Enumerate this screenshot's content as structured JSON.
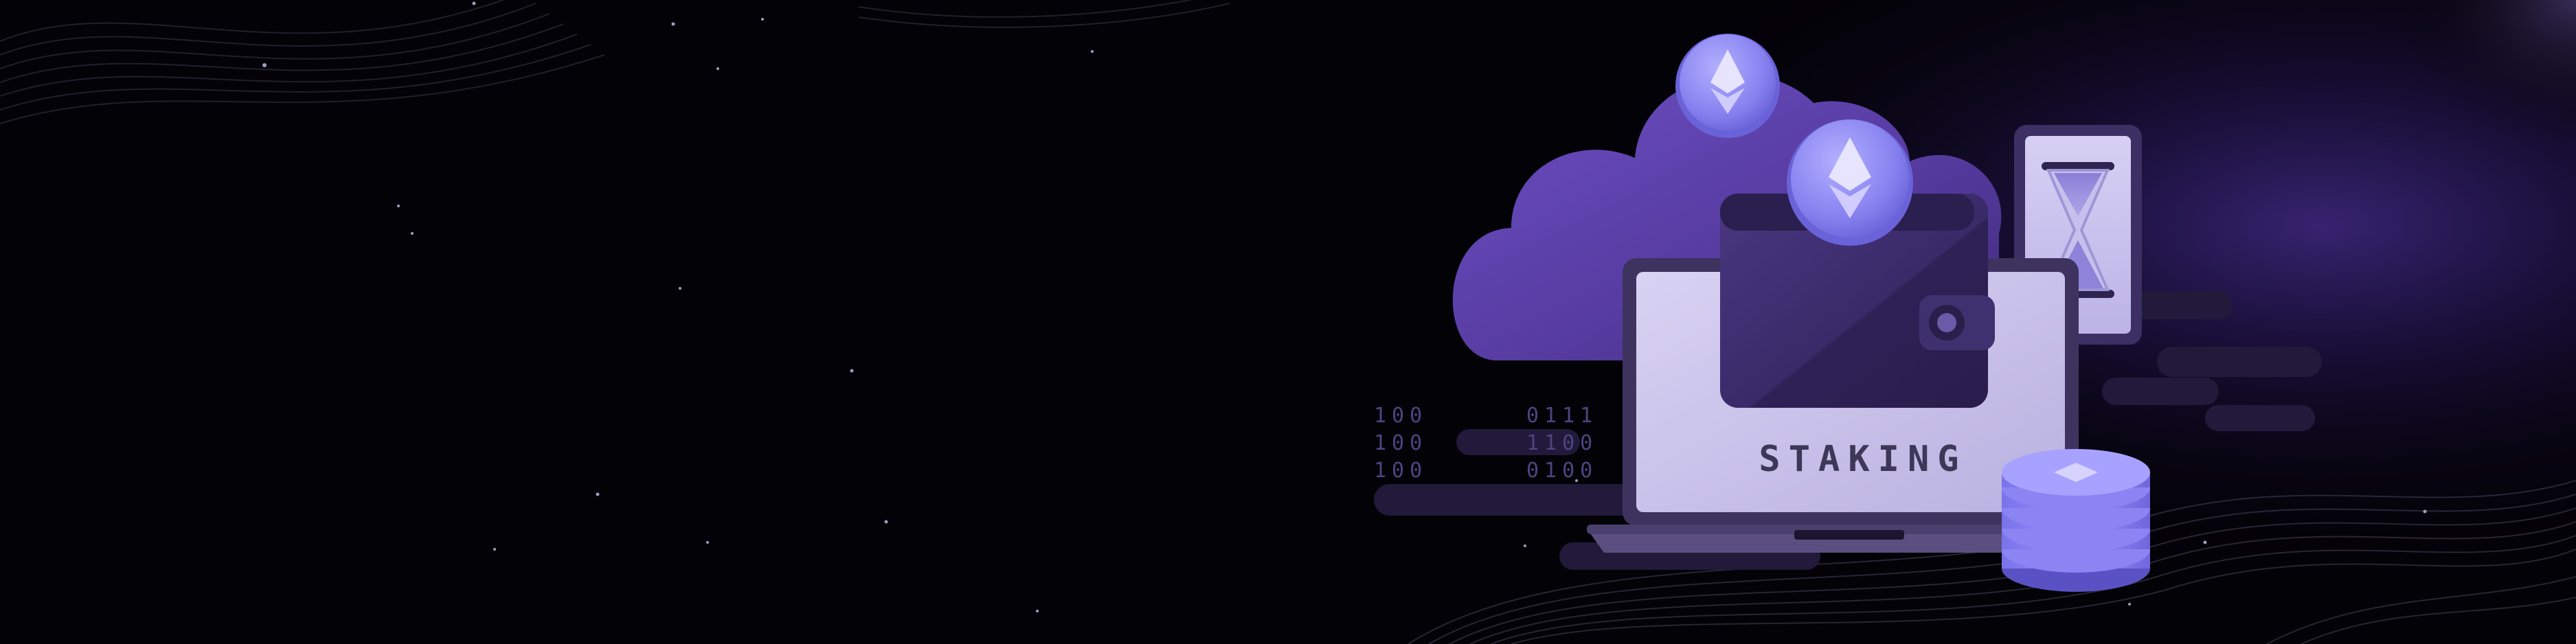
{
  "banner": {
    "screen_label": "STAKING",
    "binary_left": [
      "100",
      "100",
      "100"
    ],
    "binary_right": [
      "0111",
      "1100",
      "0100"
    ],
    "icons": [
      "ethereum-coin-icon",
      "ethereum-coin-icon",
      "wallet-icon",
      "laptop-icon",
      "phone-icon",
      "hourglass-icon",
      "coin-stack-icon",
      "cloud-icon"
    ]
  },
  "colors": {
    "background": "#030207",
    "purple_glow": "#4a2f9c",
    "cloud": "#5a45a8",
    "laptop_screen": "#c9c2ea",
    "wallet": "#3a2a66",
    "coin": "#8c86f0",
    "text_dark": "#3d3758",
    "binary_text": "#4c4580"
  }
}
